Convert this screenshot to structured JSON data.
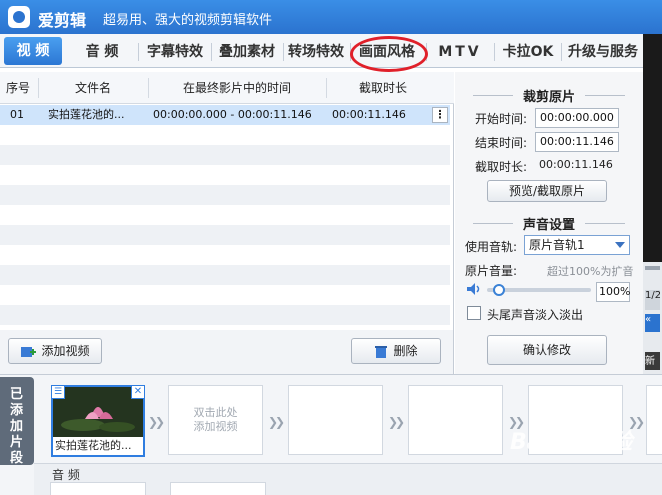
{
  "app": {
    "name": "爱剪辑",
    "slogan": "超易用、强大的视频剪辑软件"
  },
  "tabs": [
    {
      "label": "视 频",
      "active": true
    },
    {
      "label": "音 频"
    },
    {
      "label": "字幕特效"
    },
    {
      "label": "叠加素材"
    },
    {
      "label": "转场特效"
    },
    {
      "label": "画面风格"
    },
    {
      "label": "MTV"
    },
    {
      "label": "卡拉OK"
    },
    {
      "label": "升级与服务"
    }
  ],
  "table": {
    "headers": [
      "序号",
      "文件名",
      "在最终影片中的时间",
      "截取时长"
    ],
    "rows": [
      {
        "index": "01",
        "filename": "实拍莲花池的...",
        "time_range": "00:00:00.000 - 00:00:11.146",
        "duration": "00:00:11.146"
      }
    ],
    "row_menu_icon": "⋮"
  },
  "footer": {
    "add_video": "添加视频",
    "delete": "删除"
  },
  "clip_settings": {
    "title": "裁剪原片",
    "start_label": "开始时间:",
    "start_value": "00:00:00.000",
    "end_label": "结束时间:",
    "end_value": "00:00:11.146",
    "duration_label": "截取时长:",
    "duration_value": "00:00:11.146",
    "preview_button": "预览/截取原片"
  },
  "audio_settings": {
    "title": "声音设置",
    "track_label": "使用音轨:",
    "track_value": "原片音轨1",
    "volume_label": "原片音量:",
    "volume_hint": "超过100%为扩音",
    "volume_value": "100%",
    "volume_level": 0.12,
    "fade_label": "头尾声音淡入淡出",
    "confirm_button": "确认修改"
  },
  "preview_side": {
    "counter": "1/2",
    "button": "新"
  },
  "timeline": {
    "side_tab": [
      "已",
      "添",
      "加",
      "片",
      "段"
    ],
    "clip_label": "实拍莲花池的...",
    "empty_slot_hint": "双击此处\n添加视频",
    "audio_label": "音 频"
  },
  "annotation": {
    "color": "#e0202a"
  },
  "watermark": "Baidu 经验",
  "colors": {
    "accent": "#2c77d4",
    "selection": "#cfe4fb"
  }
}
